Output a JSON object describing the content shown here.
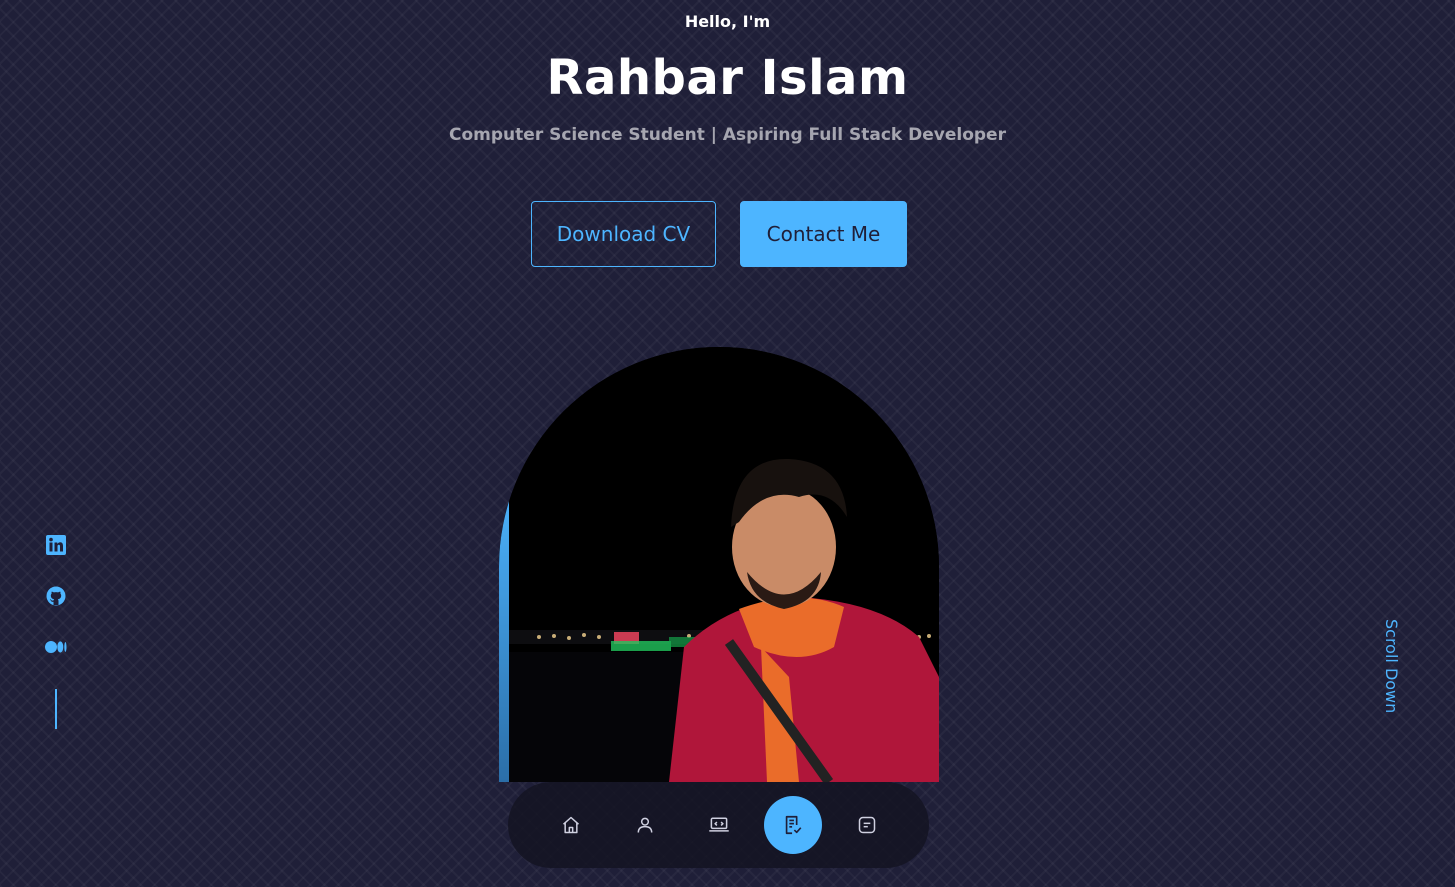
{
  "hero": {
    "greeting": "Hello, I'm",
    "name": "Rahbar Islam",
    "subtitle": "Computer Science Student | Aspiring Full Stack Developer"
  },
  "cta": {
    "download_label": "Download CV",
    "contact_label": "Contact Me"
  },
  "photo": {
    "alt": "Portrait of Rahbar Islam at night"
  },
  "socials": [
    {
      "icon": "linkedin-icon"
    },
    {
      "icon": "github-icon"
    },
    {
      "icon": "medium-icon"
    }
  ],
  "scroll": {
    "label": "Scroll Down"
  },
  "nav": {
    "items": [
      {
        "icon": "home-icon",
        "active": false
      },
      {
        "icon": "user-icon",
        "active": false
      },
      {
        "icon": "laptop-code-icon",
        "active": false
      },
      {
        "icon": "resume-check-icon",
        "active": true
      },
      {
        "icon": "message-icon",
        "active": false
      }
    ]
  },
  "colors": {
    "background": "#1f1f38",
    "accent": "#4db5ff",
    "text": "#ffffff"
  }
}
